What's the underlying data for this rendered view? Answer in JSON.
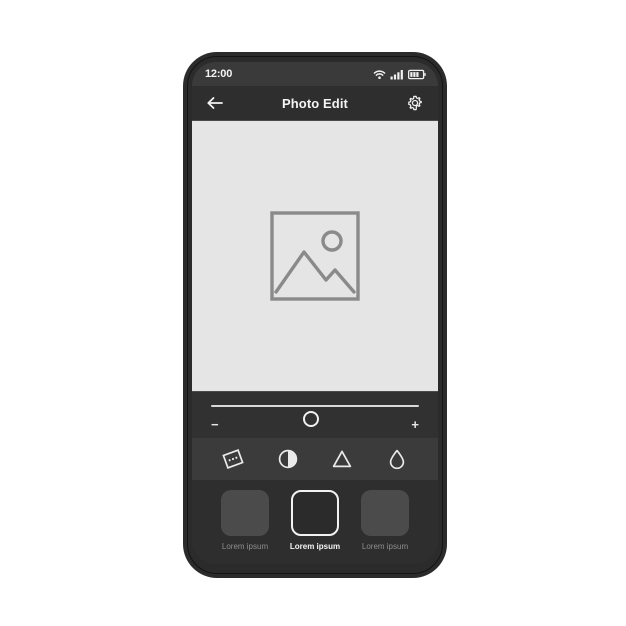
{
  "device": {
    "frame_color": "#2b2b2b",
    "screen_bg": "#333333"
  },
  "status_bar": {
    "time": "12:00",
    "icons": [
      {
        "name": "wifi-icon",
        "label": "wifi"
      },
      {
        "name": "cellular-signal-icon",
        "label": "signal",
        "bars": 4
      },
      {
        "name": "battery-icon",
        "label": "battery",
        "level": 3
      }
    ]
  },
  "app_bar": {
    "back_label": "Back",
    "title": "Photo Edit",
    "settings_label": "Settings"
  },
  "photo": {
    "placeholder_label": "Image placeholder",
    "background": "#e5e5e5",
    "stroke": "#8a8a8a"
  },
  "slider": {
    "name": "adjustment-slider",
    "value": 48,
    "min": 0,
    "max": 100,
    "decrease_label": "−",
    "increase_label": "+"
  },
  "tools": [
    {
      "name": "filter-icon",
      "label": "Filter"
    },
    {
      "name": "contrast-icon",
      "label": "Contrast"
    },
    {
      "name": "sharpen-icon",
      "label": "Sharpen"
    },
    {
      "name": "saturation-drop-icon",
      "label": "Saturation"
    }
  ],
  "thumbnails": [
    {
      "label": "Lorem ipsum",
      "selected": false
    },
    {
      "label": "Lorem ipsum",
      "selected": true
    },
    {
      "label": "Lorem ipsum",
      "selected": false
    }
  ]
}
